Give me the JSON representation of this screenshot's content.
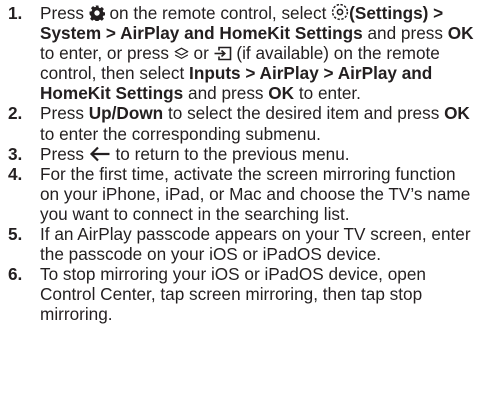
{
  "steps": [
    {
      "number": "1.",
      "parts": {
        "t0": "Press ",
        "t1": " on the remote control, select ",
        "t2": "(Settings) > System > AirPlay and HomeKit Settings",
        "t3": " and press ",
        "t4": "OK",
        "t5": " to enter, or press ",
        "t6": " or ",
        "t7": " (if available) on the remote control, then select ",
        "t8": "Inputs > AirPlay > AirPlay and HomeKit Settings",
        "t9": " and press ",
        "t10": "OK",
        "t11": " to enter."
      },
      "icons": [
        "gear-icon",
        "settings-icon",
        "layers-icon",
        "input-source-icon"
      ]
    },
    {
      "number": "2.",
      "parts": {
        "t0": "Press ",
        "t1": "Up/Down",
        "t2": " to select the desired item and press ",
        "t3": "OK",
        "t4": " to enter the corresponding submenu."
      }
    },
    {
      "number": "3.",
      "parts": {
        "t0": "Press ",
        "t1": " to return to the previous menu."
      },
      "icons": [
        "back-arrow-icon"
      ]
    },
    {
      "number": "4.",
      "text": "For the first time, activate the screen mirroring function on your iPhone, iPad, or Mac and choose the TV’s name you want to connect in the searching list."
    },
    {
      "number": "5.",
      "text": "If an AirPlay passcode appears on your TV screen, enter the passcode on your iOS or iPadOS device."
    },
    {
      "number": "6.",
      "text": "To stop mirroring your iOS or iPadOS device, open Control Center, tap screen mirroring, then tap stop mirroring."
    }
  ]
}
